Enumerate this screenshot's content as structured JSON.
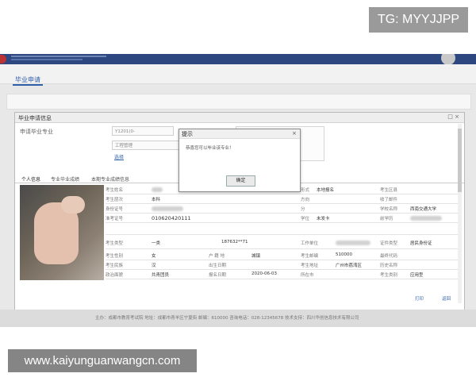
{
  "watermark": {
    "top_right": "TG: MYYJJPP",
    "bottom_left": "www.kaiyunguanwangcn.com"
  },
  "app": {
    "tab": "毕业申请"
  },
  "dialog": {
    "title": "毕业申请信息",
    "controls": "□ ×",
    "major_label": "申请毕业专业",
    "field_code": "Y1201(0-",
    "field_name": "工程管理",
    "select_link": "选择",
    "remark_label": "备注",
    "tabs": [
      "个人信息",
      "专业毕业成绩",
      "本期专业成绩信息"
    ],
    "info": {
      "name_label": "考生姓名",
      "level_label": "考生层次",
      "level_value": "本科",
      "certno_label": "身份证号",
      "examno_label": "准考证号",
      "examno_value": "010620420111",
      "type_label": "考生类型",
      "type_value": "一类",
      "gender_label": "考生性别",
      "gender_value": "女",
      "nation_label": "考生民族",
      "nation_value": "汉",
      "politics_label": "政治面貌",
      "politics_value": "共青团员",
      "form_label": "形式",
      "form_value": "本地报名",
      "direction_label": "方向",
      "score_label": "分",
      "degree_label": "学位",
      "degree_value": "未发卡",
      "phone_value": "187632**71",
      "work_label": "工作单位",
      "reg_label": "户 籍 地",
      "reg_value": "城镇",
      "birth_label": "出生日期",
      "signup_label": "报名日期",
      "signup_value": "2020-06-03",
      "zipcode_label": "考生邮编",
      "zipcode_value": "510000",
      "address_label": "考生地址",
      "address_value": "广州市荔湾区",
      "city_label": "所在市",
      "area_label": "考生区县",
      "mail_label": "收了邮件",
      "school_label": "学校名称",
      "school_value": "西南交通大学",
      "pre_label": "前学历",
      "cert_label": "证件类型",
      "cert_value": "居民身份证",
      "fin_label": "最终代码",
      "hist_label": "历史名称",
      "cat_label": "考生类别",
      "cat_value": "应用型"
    },
    "print_button": "打印",
    "back_button": "返回"
  },
  "alert": {
    "title": "提示",
    "close": "×",
    "message": "恭喜您可以毕业该专业！",
    "ok_button": "确定"
  },
  "footer": {
    "text": "主办：成都市教育考试院  地址：成都市青羊区宁夏街  邮编：610000  咨询电话：028-12345678  技术支持：四川华创信息技术有限公司"
  },
  "colors": {
    "header": "#2d4880",
    "link": "#3060a8",
    "watermark": "#9a9a9a"
  }
}
